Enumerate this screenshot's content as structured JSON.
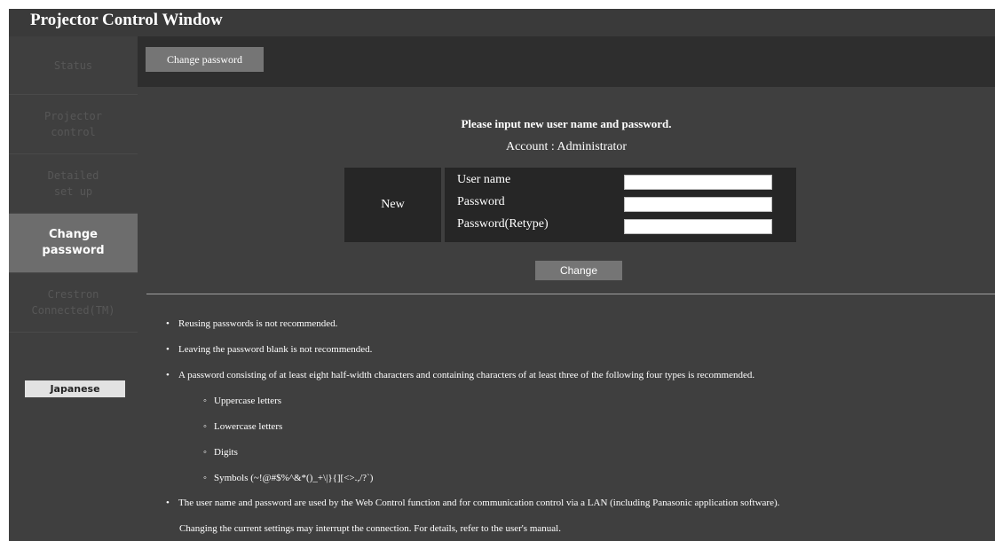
{
  "window": {
    "title": "Projector Control Window"
  },
  "sidebar": {
    "items": [
      {
        "label": "Status",
        "active": false
      },
      {
        "label": "Projector\ncontrol",
        "active": false
      },
      {
        "label": "Detailed\nset up",
        "active": false
      },
      {
        "label": "Change\npassword",
        "active": true
      },
      {
        "label": "Crestron\nConnected(TM)",
        "active": false
      }
    ],
    "language_button": "Japanese"
  },
  "tabs": [
    {
      "label": "Change password"
    }
  ],
  "form": {
    "heading": "Please input new user name and password.",
    "account": "Account : Administrator",
    "new_label": "New",
    "fields": [
      {
        "label": "User name",
        "value": ""
      },
      {
        "label": "Password",
        "value": ""
      },
      {
        "label": "Password(Retype)",
        "value": ""
      }
    ],
    "change_button": "Change"
  },
  "notes": {
    "bullets": [
      "Reusing passwords is not recommended.",
      "Leaving the password blank is not recommended.",
      "A password consisting of at least eight half-width characters and containing characters of at least three of the following four types is recommended."
    ],
    "sub_bullets": [
      "Uppercase letters",
      "Lowercase letters",
      "Digits",
      "Symbols (~!@#$%^&*()_+\\|}{][<>.,/?`)"
    ],
    "last_bullet": "The user name and password are used by the Web Control function and for communication control via a LAN (including Panasonic application software).",
    "last_note": "Changing the current settings may interrupt the connection. For details, refer to the user's manual.",
    "bullet_char": "•",
    "sub_bullet_char": "◦"
  },
  "colors": {
    "background": "#3f3f3f",
    "tab_bar": "#2e2e2e",
    "button": "#757575",
    "active_nav": "#6d6d6d",
    "form_cell": "#262626",
    "inactive_nav_text": "#575757"
  }
}
